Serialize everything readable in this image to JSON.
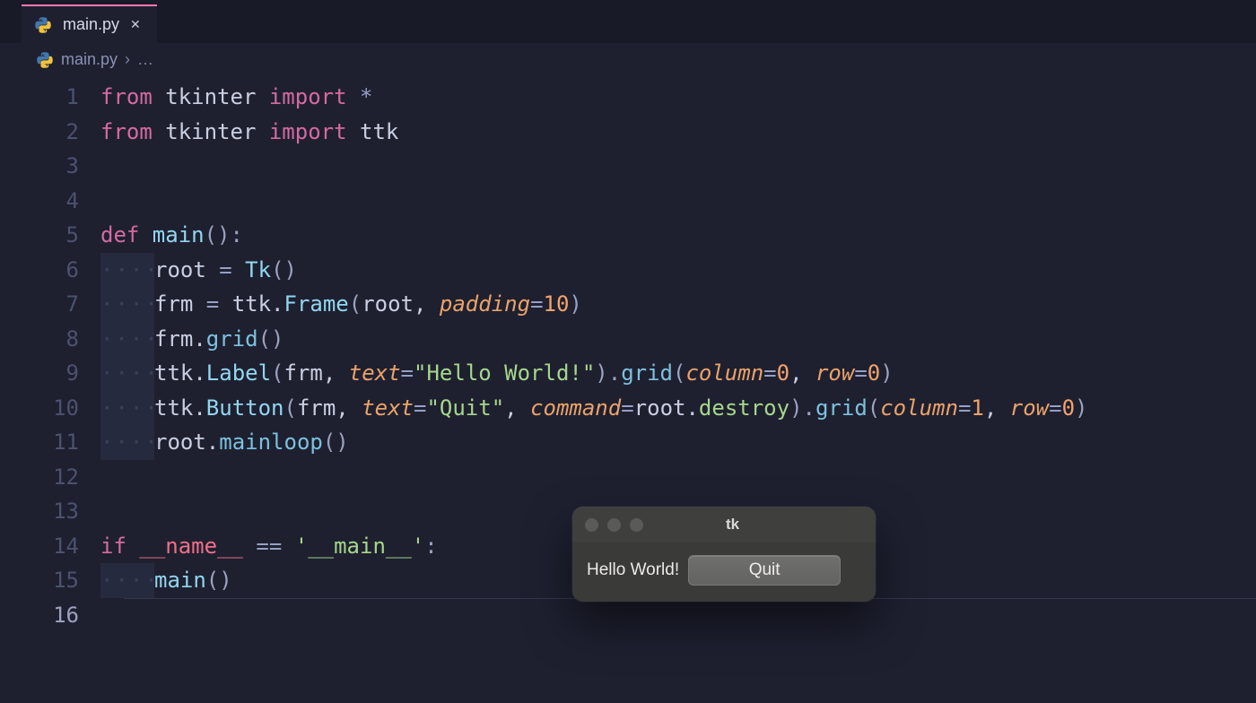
{
  "tab": {
    "filename": "main.py"
  },
  "breadcrumb": {
    "file": "main.py",
    "section": "…"
  },
  "lines": {
    "n1": "1",
    "n2": "2",
    "n3": "3",
    "n4": "4",
    "n5": "5",
    "n6": "6",
    "n7": "7",
    "n8": "8",
    "n9": "9",
    "n10": "10",
    "n11": "11",
    "n12": "12",
    "n13": "13",
    "n14": "14",
    "n15": "15",
    "n16": "16"
  },
  "code": {
    "l1_from": "from",
    "l1_mod": " tkinter ",
    "l1_import": "import",
    "l1_star": " *",
    "l2_from": "from",
    "l2_mod": " tkinter ",
    "l2_import": "import",
    "l2_what": " ttk",
    "l5_def": "def ",
    "l5_fn": "main",
    "l5_paren": "():",
    "l6_root": "root ",
    "l6_eq": "=",
    "l6_sp": " ",
    "l6_tk": "Tk",
    "l6_p": "()",
    "l7_frm": "frm ",
    "l7_eq": "=",
    "l7_ttk": " ttk.",
    "l7_frame": "Frame",
    "l7_open": "(",
    "l7_root": "root, ",
    "l7_padding": "padding",
    "l7_eq2": "=",
    "l7_ten": "10",
    "l7_close": ")",
    "l8_frm": "frm.",
    "l8_grid": "grid",
    "l8_p": "()",
    "l9_ttk": "ttk.",
    "l9_label": "Label",
    "l9_open": "(",
    "l9_frm": "frm, ",
    "l9_text": "text",
    "l9_eq": "=",
    "l9_str": "\"Hello World!\"",
    "l9_close": ").",
    "l9_grid": "grid",
    "l9_open2": "(",
    "l9_col": "column",
    "l9_eq2": "=",
    "l9_zero": "0",
    "l9_comma": ", ",
    "l9_row": "row",
    "l9_eq3": "=",
    "l9_zero2": "0",
    "l9_close2": ")",
    "l10_ttk": "ttk.",
    "l10_button": "Button",
    "l10_open": "(",
    "l10_frm": "frm, ",
    "l10_text": "text",
    "l10_eq": "=",
    "l10_str": "\"Quit\"",
    "l10_comma": ", ",
    "l10_command": "command",
    "l10_eq2": "=",
    "l10_root": "root.",
    "l10_destroy": "destroy",
    "l10_close": ").",
    "l10_grid": "grid",
    "l10_open2": "(",
    "l10_col": "column",
    "l10_eq3": "=",
    "l10_one": "1",
    "l10_comma2": ", ",
    "l10_row": "row",
    "l10_eq4": "=",
    "l10_zero": "0",
    "l10_close2": ")",
    "l11_root": "root.",
    "l11_mainloop": "mainloop",
    "l11_p": "()",
    "l14_if": "if ",
    "l14_name": "__name__",
    "l14_eq": " == ",
    "l14_main": "'__main__'",
    "l14_colon": ":",
    "l15_main": "main",
    "l15_p": "()"
  },
  "indent_dots": "····",
  "tkwin": {
    "title": "tk",
    "label": "Hello World!",
    "button": "Quit"
  }
}
